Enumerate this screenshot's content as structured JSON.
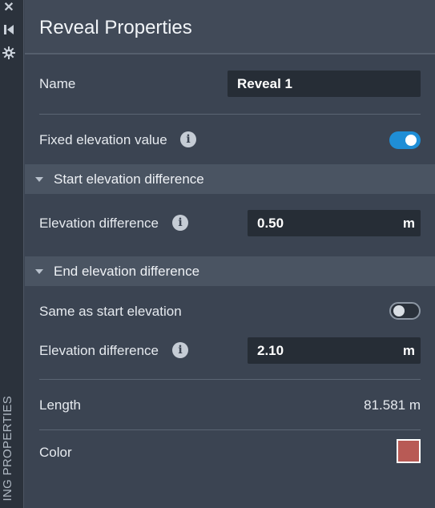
{
  "rail": {
    "icons": [
      "close-icon",
      "collapse-icon",
      "settings-icon"
    ],
    "vertical_label": "ING PROPERTIES"
  },
  "panel": {
    "title": "Reveal Properties"
  },
  "name_row": {
    "label": "Name",
    "value": "Reveal 1"
  },
  "fixed_elevation": {
    "label": "Fixed elevation value",
    "enabled": true
  },
  "start_section": {
    "title": "Start elevation difference",
    "elevation_label": "Elevation difference",
    "elevation_value": "0.50",
    "unit": "m"
  },
  "end_section": {
    "title": "End elevation difference",
    "same_as_start_label": "Same as start elevation",
    "same_as_start_enabled": false,
    "elevation_label": "Elevation difference",
    "elevation_value": "2.10",
    "unit": "m"
  },
  "length": {
    "label": "Length",
    "value": "81.581 m"
  },
  "color": {
    "label": "Color",
    "swatch": "#b85a55"
  },
  "colors": {
    "accent": "#1f8ed6",
    "panel_bg": "#3b4452",
    "section_bg": "#4a5462",
    "field_bg": "#262d36"
  }
}
